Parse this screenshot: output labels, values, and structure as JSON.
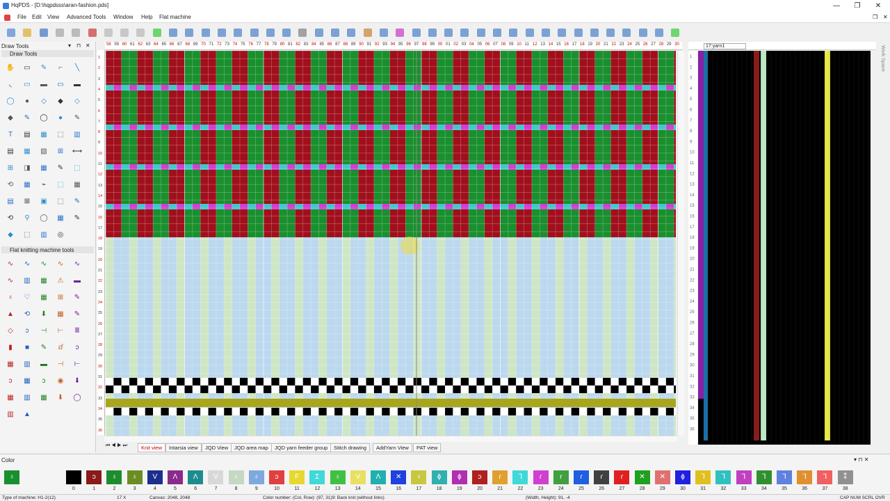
{
  "window": {
    "title": "HqPDS - [D:\\hqpdsss\\aran-fashion.pds]",
    "min": "—",
    "max": "❐",
    "close": "✕"
  },
  "menu": [
    "File",
    "Edit",
    "View",
    "Advanced Tools",
    "Window",
    "Help",
    "Flat machine"
  ],
  "panels": {
    "draw_tools_header": "Draw Tools",
    "draw_tools_sub": "Draw Tools",
    "flat_tools": "Flat knitting machine tools",
    "color_header": "Color"
  },
  "right_panel": {
    "yarn_label": "17:yarn1",
    "workspace": "Work Space"
  },
  "tabs": [
    "Knit view",
    "Intarsia view",
    "JQD View",
    "JQD area map",
    "JQD yarn feeder group",
    "Stitch drawing",
    "AddYarn View",
    "PAT view"
  ],
  "colors": {
    "red": "#a0101c",
    "green": "#1a8f2e",
    "light_blue": "#bcd8ee",
    "light_green": "#cfe6c4",
    "yellow_band": "#a9a61e",
    "magenta": "#d23fd2",
    "cyan": "#43c8c8",
    "accent_yellow": "#e8e84a"
  },
  "swatches": [
    {
      "n": "0",
      "c": "#000000",
      "g": ""
    },
    {
      "n": "1",
      "c": "#8b1a1a",
      "g": "ↄ"
    },
    {
      "n": "2",
      "c": "#1e8c2e",
      "g": "♁"
    },
    {
      "n": "3",
      "c": "#6b8e23",
      "g": "♁"
    },
    {
      "n": "4",
      "c": "#1d2f8c",
      "g": "V"
    },
    {
      "n": "5",
      "c": "#8a2a8a",
      "g": "Λ"
    },
    {
      "n": "6",
      "c": "#1e8c8c",
      "g": "Λ"
    },
    {
      "n": "7",
      "c": "#d8d8d8",
      "g": "V"
    },
    {
      "n": "8",
      "c": "#c4d8c4",
      "g": "♁"
    },
    {
      "n": "9",
      "c": "#7da9e0",
      "g": "♁"
    },
    {
      "n": "10",
      "c": "#e04040",
      "g": "ↄ"
    },
    {
      "n": "11",
      "c": "#e6d830",
      "g": "F"
    },
    {
      "n": "12",
      "c": "#40d8d8",
      "g": "Ʃ"
    },
    {
      "n": "13",
      "c": "#40c040",
      "g": "♁"
    },
    {
      "n": "14",
      "c": "#e8e060",
      "g": "V"
    },
    {
      "n": "15",
      "c": "#20b0b0",
      "g": "Λ"
    },
    {
      "n": "16",
      "c": "#2040e0",
      "g": "✕"
    },
    {
      "n": "17",
      "c": "#c8c840",
      "g": "♁"
    },
    {
      "n": "18",
      "c": "#30b0b0",
      "g": "ɸ"
    },
    {
      "n": "19",
      "c": "#b030b0",
      "g": "ɸ"
    },
    {
      "n": "20",
      "c": "#b02020",
      "g": "ↄ"
    },
    {
      "n": "21",
      "c": "#e0a030",
      "g": "ɾ"
    },
    {
      "n": "22",
      "c": "#40d8d8",
      "g": "Ꞁ"
    },
    {
      "n": "23",
      "c": "#d040d0",
      "g": "ɾ"
    },
    {
      "n": "24",
      "c": "#40a040",
      "g": "ɾ"
    },
    {
      "n": "25",
      "c": "#2060e0",
      "g": "ɾ"
    },
    {
      "n": "26",
      "c": "#404040",
      "g": "ɾ"
    },
    {
      "n": "27",
      "c": "#e02020",
      "g": "ɾ"
    },
    {
      "n": "28",
      "c": "#20a020",
      "g": "✕"
    },
    {
      "n": "29",
      "c": "#e07070",
      "g": "✕"
    },
    {
      "n": "30",
      "c": "#2020e0",
      "g": "ɸ"
    },
    {
      "n": "31",
      "c": "#e0c020",
      "g": "Ꞁ"
    },
    {
      "n": "32",
      "c": "#30c0c0",
      "g": "Ꞁ"
    },
    {
      "n": "33",
      "c": "#c040c0",
      "g": "Ꞁ"
    },
    {
      "n": "34",
      "c": "#309030",
      "g": "Ꞁ"
    },
    {
      "n": "35",
      "c": "#6080e0",
      "g": "Ꞁ"
    },
    {
      "n": "36",
      "c": "#e09030",
      "g": "Ꞁ"
    },
    {
      "n": "37",
      "c": "#f06060",
      "g": "Ꞁ"
    },
    {
      "n": "38",
      "c": "#909090",
      "g": "⁑"
    }
  ],
  "status": {
    "machine": "Type of machine: H1-2(12)",
    "zoom": "17 X",
    "canvas": "Canvas: 2048, 2048",
    "color_info": "Color number: (Col, Row): (97, 31)9: Back knit (without links)",
    "wh": "(Width, Height): 91, -4",
    "caps": "CAP NUM SCRL OVR"
  },
  "ruler": {
    "ticks": [
      "58",
      "59",
      "60",
      "61",
      "62",
      "63",
      "64",
      "65",
      "66",
      "67",
      "68",
      "69",
      "70",
      "71",
      "72",
      "73",
      "74",
      "75",
      "76",
      "77",
      "78",
      "79",
      "80",
      "81",
      "82",
      "83",
      "84",
      "85",
      "86",
      "87",
      "88",
      "89",
      "90",
      "91",
      "92",
      "93",
      "94",
      "95",
      "96",
      "97",
      "98",
      "99",
      "00",
      "01",
      "02",
      "03",
      "04",
      "05",
      "06",
      "07",
      "08",
      "09",
      "10",
      "11",
      "12",
      "13",
      "14",
      "15",
      "16",
      "17",
      "18",
      "19",
      "20",
      "21",
      "22",
      "23",
      "24",
      "25",
      "26",
      "27",
      "28",
      "29",
      "30"
    ]
  },
  "vruler": {
    "ticks": [
      "1",
      "2",
      "3",
      "4",
      "5",
      "6",
      "7",
      "8",
      "9",
      "10",
      "11",
      "12",
      "13",
      "14",
      "15",
      "16",
      "17",
      "18",
      "19",
      "20",
      "21",
      "22",
      "23",
      "24",
      "25",
      "26",
      "27",
      "28",
      "29",
      "30",
      "31",
      "32",
      "33",
      "34",
      "35",
      "36"
    ]
  }
}
